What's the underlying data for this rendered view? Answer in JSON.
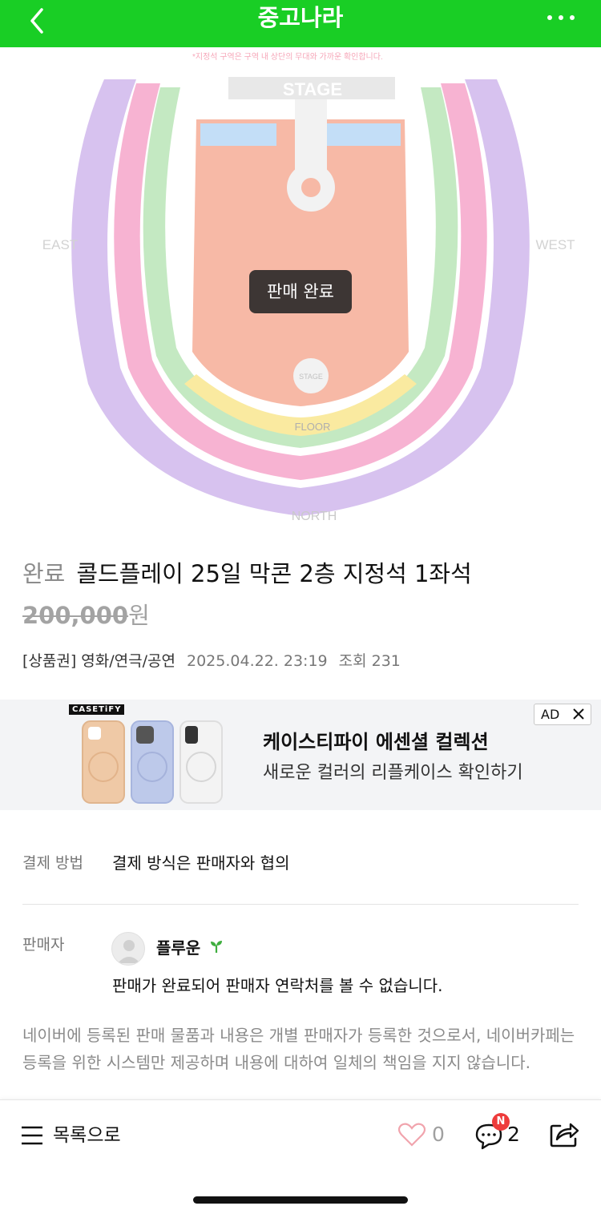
{
  "header": {
    "title": "중고나라",
    "back_icon": "chevron-left-icon",
    "more_icon": "more-horizontal-icon",
    "color": "#19ce25"
  },
  "seatmap": {
    "notice": "*지정석 구역은 구역 내 상단의 무대와 가까운 확인합니다.",
    "stage": "STAGE",
    "east": "EAST",
    "west": "WEST",
    "north": "NORTH",
    "floor": "FLOOR",
    "stage_b": "STAGE",
    "sold_badge": "판매 완료"
  },
  "product": {
    "state": "완료",
    "title": "콜드플레이 25일 막콘 2층 지정석 1좌석",
    "price": "200,000",
    "price_unit": "원",
    "category": "[상품권] 영화/연극/공연",
    "date": "2025.04.22. 23:19",
    "views": "조회 231"
  },
  "ad": {
    "brand": "CASETiFY",
    "title": "케이스티파이 에센셜 컬렉션",
    "subtitle": "새로운 컬러의 리플케이스 확인하기",
    "tag": "AD"
  },
  "payment": {
    "label": "결제 방법",
    "value": "결제 방식은 판매자와 협의"
  },
  "seller": {
    "label": "판매자",
    "name": "플루운",
    "note": "판매가 완료되어 판매자 연락처를 볼 수 없습니다."
  },
  "disclaimer": "네이버에 등록된 판매 물품과 내용은 개별 판매자가 등록한 것으로서, 네이버카페는 등록을 위한 시스템만 제공하며 내용에 대하여 일체의 책임을 지지 않습니다.",
  "bottombar": {
    "list_label": "목록으로",
    "likes": "0",
    "comments": "2",
    "new_badge": "N"
  }
}
